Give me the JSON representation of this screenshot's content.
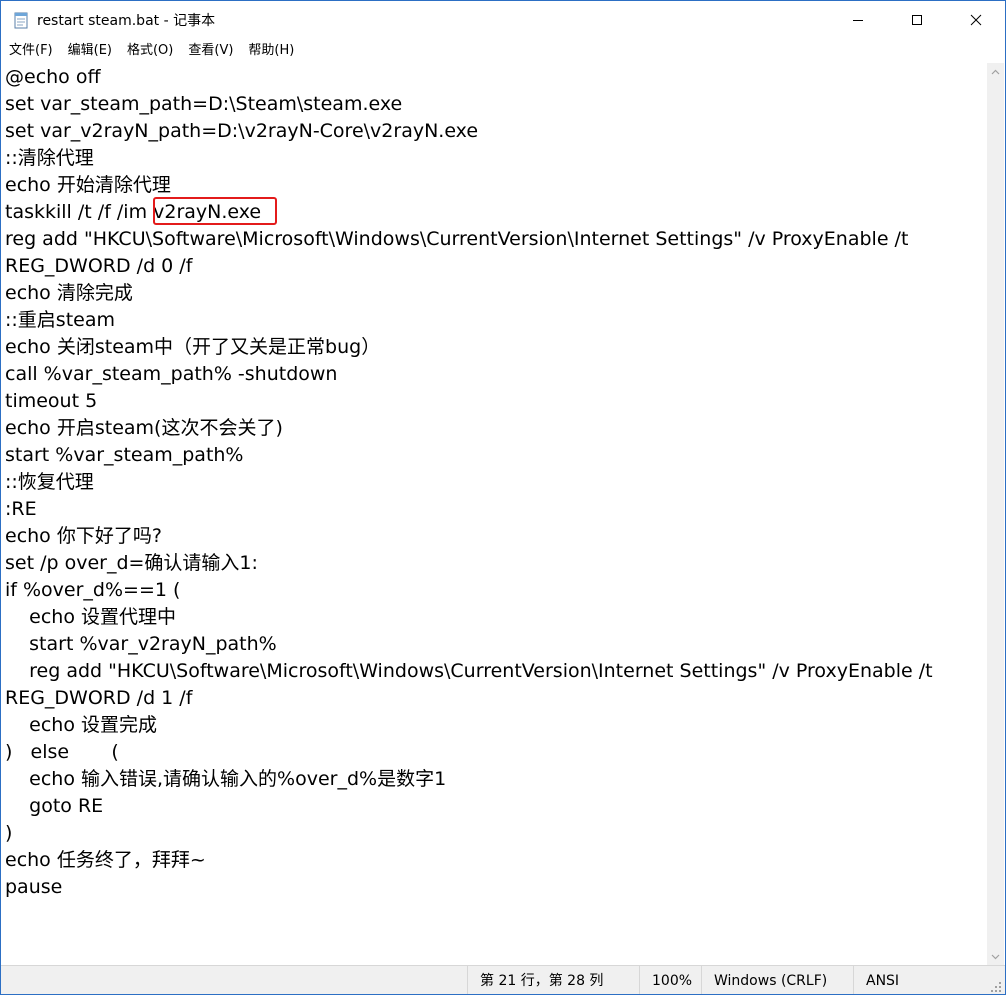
{
  "window": {
    "title": "restart steam.bat - 记事本",
    "minimize_symbol": "—",
    "maximize_symbol": "☐",
    "close_symbol": "✕"
  },
  "menu": {
    "items": [
      "文件(F)",
      "编辑(E)",
      "格式(O)",
      "查看(V)",
      "帮助(H)"
    ]
  },
  "editor": {
    "lines": [
      "@echo off",
      "set var_steam_path=D:\\Steam\\steam.exe",
      "set var_v2rayN_path=D:\\v2rayN-Core\\v2rayN.exe",
      "::清除代理",
      "echo 开始清除代理",
      "taskkill /t /f /im v2rayN.exe",
      "reg add \"HKCU\\Software\\Microsoft\\Windows\\CurrentVersion\\Internet Settings\" /v ProxyEnable /t",
      "REG_DWORD /d 0 /f",
      "echo 清除完成",
      "::重启steam",
      "echo 关闭steam中（开了又关是正常bug）",
      "call %var_steam_path% -shutdown",
      "timeout 5",
      "echo 开启steam(这次不会关了)",
      "start %var_steam_path%",
      "::恢复代理",
      ":RE",
      "echo 你下好了吗?",
      "set /p over_d=确认请输入1:",
      "if %over_d%==1 (",
      "    echo 设置代理中",
      "    start %var_v2rayN_path%",
      "    reg add \"HKCU\\Software\\Microsoft\\Windows\\CurrentVersion\\Internet Settings\" /v ProxyEnable /t",
      "REG_DWORD /d 1 /f",
      "    echo 设置完成",
      ")   else       (",
      "    echo 输入错误,请确认输入的%over_d%是数字1",
      "    goto RE",
      ")",
      "echo 任务终了，拜拜~",
      "pause"
    ]
  },
  "statusbar": {
    "position": "第 21 行，第 28 列",
    "zoom": "100%",
    "line_ending": "Windows (CRLF)",
    "encoding": "ANSI"
  },
  "colors": {
    "highlight_border": "#e31b1b",
    "statusbar_bg": "#f0f0f0"
  }
}
